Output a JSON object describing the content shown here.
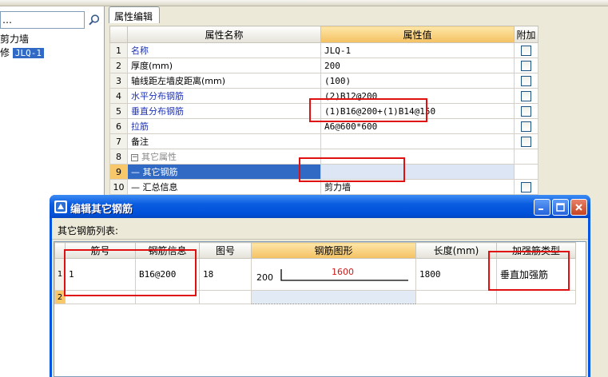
{
  "left_panel": {
    "search_text": "…",
    "tree": [
      {
        "label": "剪力墙"
      },
      {
        "label": "JLQ-1",
        "prefix": "修"
      }
    ]
  },
  "props": {
    "tab_label": "属性编辑",
    "columns": {
      "name": "属性名称",
      "value": "属性值",
      "extra": "附加"
    },
    "rows": [
      {
        "num": "1",
        "name": "名称",
        "value": "JLQ-1"
      },
      {
        "num": "2",
        "name": "厚度(mm)",
        "value": "200"
      },
      {
        "num": "3",
        "name": "轴线距左墙皮距离(mm)",
        "value": "(100)"
      },
      {
        "num": "4",
        "name": "水平分布钢筋",
        "value": "(2)B12@200"
      },
      {
        "num": "5",
        "name": "垂直分布钢筋",
        "value": "(1)B16@200+(1)B14@150"
      },
      {
        "num": "6",
        "name": "拉筋",
        "value": "A6@600*600"
      },
      {
        "num": "7",
        "name": "备注",
        "value": ""
      },
      {
        "num": "8",
        "name": "其它属性",
        "expander": "−",
        "value": ""
      },
      {
        "num": "9",
        "name": "— 其它钢筋",
        "value": ""
      },
      {
        "num": "10",
        "name": "— 汇总信息",
        "value": "剪力墙"
      }
    ]
  },
  "dialog": {
    "title": "编辑其它钢筋",
    "list_label": "其它钢筋列表:",
    "columns": {
      "num": "筋号",
      "info": "钢筋信息",
      "fig": "图号",
      "shape": "钢筋图形",
      "length": "长度(mm)",
      "type": "加强筋类型"
    },
    "rows": [
      {
        "idx": "1",
        "num": "1",
        "info": "B16@200",
        "fig": "18",
        "shape_left": "200",
        "shape_mid": "1600",
        "length": "1800",
        "type": "垂直加强筋"
      },
      {
        "idx": "2",
        "num": "",
        "info": "",
        "fig": "",
        "shape_left": "",
        "shape_mid": "",
        "length": "",
        "type": ""
      }
    ]
  },
  "colors": {
    "selection": "#316ac5",
    "highlight_header": "#f4c162",
    "annotation_red": "#e01010",
    "title_bar": "#0054e3",
    "link_blue": "#1e32b4"
  }
}
